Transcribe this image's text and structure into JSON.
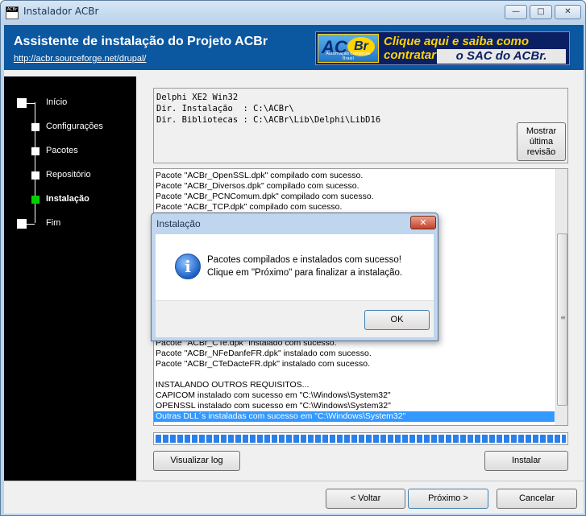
{
  "window": {
    "title": "Instalador ACBr",
    "icon_text": "ACBr",
    "controls": {
      "minimize": "—",
      "maximize": "□",
      "close": "✕"
    }
  },
  "header": {
    "title": "Assistente de instalação do Projeto ACBr",
    "link": "http://acbr.sourceforge.net/drupal/",
    "banner": {
      "logo_ac": "AC",
      "logo_br": "Br",
      "logo_sub": "Automação Comercial Brasil",
      "line1": "Clique aqui e saiba como contratar",
      "line2": "o SAC do ACBr."
    }
  },
  "steps": [
    {
      "label": "Início",
      "active": false
    },
    {
      "label": "Configurações",
      "active": false
    },
    {
      "label": "Pacotes",
      "active": false
    },
    {
      "label": "Repositório",
      "active": false
    },
    {
      "label": "Instalação",
      "active": true
    },
    {
      "label": "Fim",
      "active": false
    }
  ],
  "info": {
    "text": "Delphi XE2 Win32\nDir. Instalação  : C:\\ACBr\\\nDir. Bibliotecas : C:\\ACBr\\Lib\\Delphi\\LibD16",
    "show_last_revision": "Mostrar\núltima\nrevisão"
  },
  "log": {
    "lines_top": [
      "Pacote \"ACBr_OpenSSL.dpk\" compilado com sucesso.",
      "Pacote \"ACBr_Diversos.dpk\" compilado com sucesso.",
      "Pacote \"ACBr_PCNComum.dpk\" compilado com sucesso.",
      "Pacote \"ACBr_TCP.dpk\" compilado com sucesso."
    ],
    "lines_bottom": [
      "Pacote \"ACBr_CTe.dpk\" instalado com sucesso.",
      "Pacote \"ACBr_NFeDanfeFR.dpk\" instalado com sucesso.",
      "Pacote \"ACBr_CTeDacteFR.dpk\" instalado com sucesso.",
      "",
      "INSTALANDO OUTROS REQUISITOS...",
      "CAPICOM instalado com sucesso em \"C:\\Windows\\System32\"",
      "OPENSSL instalado com sucesso em \"C:\\Windows\\System32\""
    ],
    "selected_line": "Outras DLL´s instaladas com sucesso em \"C:\\Windows\\System32\""
  },
  "progress": {
    "percent": 100,
    "color": "#2a80e8"
  },
  "buttons": {
    "view_log": "Visualizar log",
    "install": "Instalar",
    "back": "< Voltar",
    "next": "Próximo >",
    "cancel": "Cancelar"
  },
  "dialog": {
    "title": "Instalação",
    "line1": "Pacotes compilados e instalados com sucesso!",
    "line2": "Clique em \"Próximo\" para finalizar a instalação.",
    "ok": "OK",
    "icon": "info-icon"
  },
  "colors": {
    "header_bg": "#0b57a0",
    "steps_bg": "#000000",
    "active_step": "#00d000",
    "selection": "#3399ff"
  }
}
